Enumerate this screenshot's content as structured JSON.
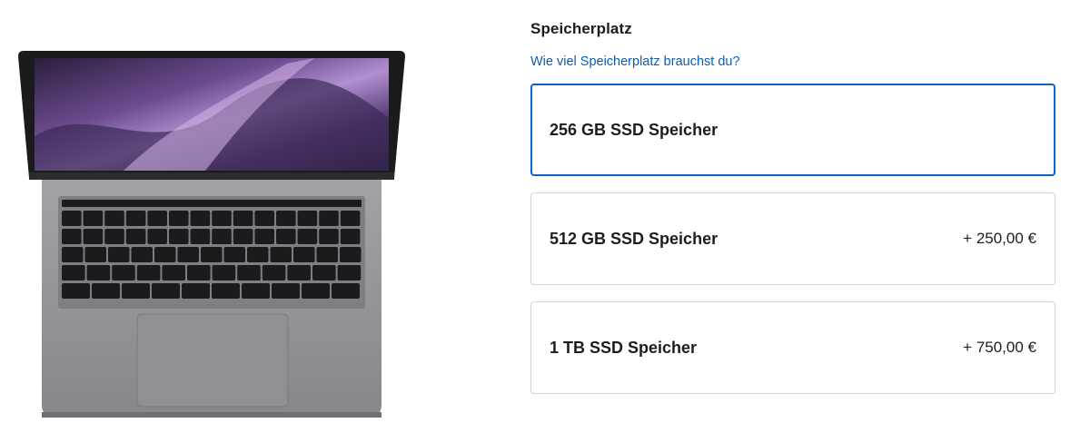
{
  "product": {
    "image_alt": "MacBook Pro laptop",
    "colors": {
      "body": "#8e8f93",
      "screen_frame": "#1a1a1c",
      "keys": "#1b1b1d"
    }
  },
  "storage": {
    "title": "Speicherplatz",
    "help_link": "Wie viel Speicherplatz brauchst du?",
    "options": [
      {
        "label": "256 GB SSD Speicher",
        "price": "",
        "selected": true
      },
      {
        "label": "512 GB SSD Speicher",
        "price": "+ 250,00 €",
        "selected": false
      },
      {
        "label": "1 TB SSD Speicher",
        "price": "+ 750,00 €",
        "selected": false
      }
    ]
  },
  "colors": {
    "accent": "#0b63c9",
    "link": "#0a5fb5",
    "border": "#d2d2d7"
  }
}
